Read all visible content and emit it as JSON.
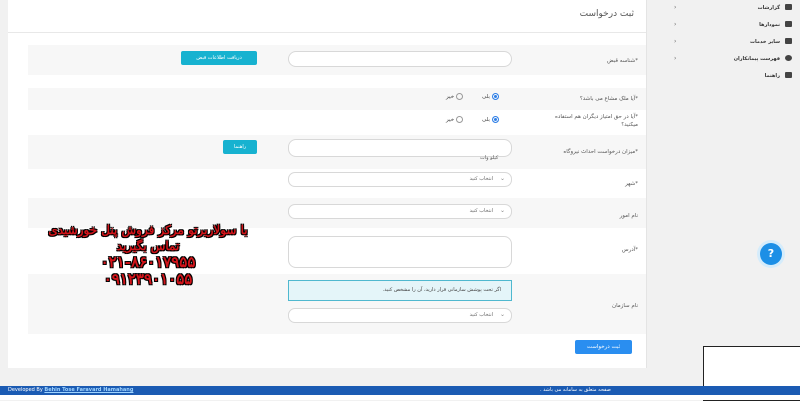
{
  "page": {
    "title": "ثبت درخواست"
  },
  "form": {
    "receipt_id": {
      "label": "*شناسه قبض",
      "button": "دریافت اطلاعات قبض"
    },
    "owner": {
      "label": "*آیا ملک مشاع می باشد؟",
      "yes": "بلی",
      "no": "خیر",
      "selected": "yes"
    },
    "others": {
      "label": "*آیا در حق امتیاز دیگران هم استفاده میکنید؟",
      "yes": "بلی",
      "no": "خیر",
      "selected": "yes"
    },
    "power": {
      "label": "*میزان درخواست احداث نیروگاه",
      "unit": "کیلو وات",
      "button": "راهنما"
    },
    "city": {
      "label": "*شهر",
      "placeholder": "انتخاب کنید"
    },
    "affairs": {
      "label": "نام امور",
      "placeholder": "انتخاب کنید"
    },
    "address": {
      "label": "*آدرس"
    },
    "org": {
      "label": "نام سازمان",
      "info": "اگر تحت پوشش سازمانی قرار دارید، آن را مشخص کنید.",
      "placeholder": "انتخاب کنید"
    },
    "submit": "ثبت درخواست"
  },
  "watermark": {
    "line1": "با سولاریرتو مرکز فروش پنل خورشیدی",
    "line2": "تماس بگیرید",
    "line3": "۰۲۱-۸۶۰۱۷۹۵۵",
    "line4": "۰۹۱۲۳۹۰۱۰۵۵"
  },
  "sidebar": {
    "items": [
      {
        "label": "گزارشات",
        "icon": "chart-icon",
        "arrow": "‹"
      },
      {
        "label": "نمودارها",
        "icon": "chart-icon",
        "arrow": "‹"
      },
      {
        "label": "سایر خدمات",
        "icon": "grid-icon",
        "arrow": "‹"
      },
      {
        "label": "فهرست پیمانکاران",
        "icon": "users-icon",
        "arrow": "‹"
      },
      {
        "label": "راهنما",
        "icon": "book-icon",
        "arrow": ""
      }
    ]
  },
  "help": {
    "glyph": "?"
  },
  "footer": {
    "left_prefix": "Developed By",
    "left_link": "Behin Tose Faravard Hamahang",
    "right": "صفحه متعلق به سامانه می باشد ."
  },
  "colors": {
    "accent": "#17b2d0",
    "primary": "#2a8ef0",
    "footer": "#1b5bb3",
    "watermark": "#d2141a"
  }
}
